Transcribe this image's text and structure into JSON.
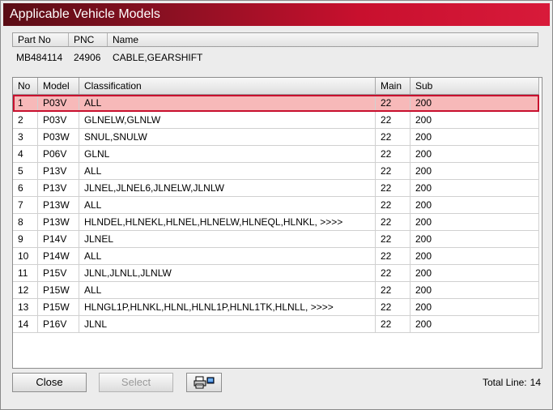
{
  "window": {
    "title": "Applicable Vehicle Models"
  },
  "part": {
    "headers": [
      "Part No",
      "PNC",
      "Name"
    ],
    "values": {
      "part_no": "MB484114",
      "pnc": "24906",
      "name": "CABLE,GEARSHIFT"
    }
  },
  "grid": {
    "columns": [
      "No",
      "Model",
      "Classification",
      "Main",
      "Sub"
    ],
    "selected_index": 0,
    "rows": [
      {
        "no": "1",
        "model": "P03V",
        "classification": "ALL",
        "main": "22",
        "sub": "200"
      },
      {
        "no": "2",
        "model": "P03V",
        "classification": "GLNELW,GLNLW",
        "main": "22",
        "sub": "200"
      },
      {
        "no": "3",
        "model": "P03W",
        "classification": "SNUL,SNULW",
        "main": "22",
        "sub": "200"
      },
      {
        "no": "4",
        "model": "P06V",
        "classification": "GLNL",
        "main": "22",
        "sub": "200"
      },
      {
        "no": "5",
        "model": "P13V",
        "classification": "ALL",
        "main": "22",
        "sub": "200"
      },
      {
        "no": "6",
        "model": "P13V",
        "classification": "JLNEL,JLNEL6,JLNELW,JLNLW",
        "main": "22",
        "sub": "200"
      },
      {
        "no": "7",
        "model": "P13W",
        "classification": "ALL",
        "main": "22",
        "sub": "200"
      },
      {
        "no": "8",
        "model": "P13W",
        "classification": "HLNDEL,HLNEKL,HLNEL,HLNELW,HLNEQL,HLNKL,  >>>>",
        "main": "22",
        "sub": "200"
      },
      {
        "no": "9",
        "model": "P14V",
        "classification": "JLNEL",
        "main": "22",
        "sub": "200"
      },
      {
        "no": "10",
        "model": "P14W",
        "classification": "ALL",
        "main": "22",
        "sub": "200"
      },
      {
        "no": "11",
        "model": "P15V",
        "classification": "JLNL,JLNLL,JLNLW",
        "main": "22",
        "sub": "200"
      },
      {
        "no": "12",
        "model": "P15W",
        "classification": "ALL",
        "main": "22",
        "sub": "200"
      },
      {
        "no": "13",
        "model": "P15W",
        "classification": "HLNGL1P,HLNKL,HLNL,HLNL1P,HLNL1TK,HLNLL,  >>>>",
        "main": "22",
        "sub": "200"
      },
      {
        "no": "14",
        "model": "P16V",
        "classification": "JLNL",
        "main": "22",
        "sub": "200"
      }
    ]
  },
  "footer": {
    "close_label": "Close",
    "select_label": "Select",
    "print_icon": "printer-icon",
    "total_label": "Total Line:",
    "total_value": "14"
  },
  "colors": {
    "title_gradient_start": "#5a0d15",
    "title_gradient_end": "#d81a3a",
    "selected_row_bg": "#f7b9b9",
    "selected_row_border": "#c8102e"
  }
}
